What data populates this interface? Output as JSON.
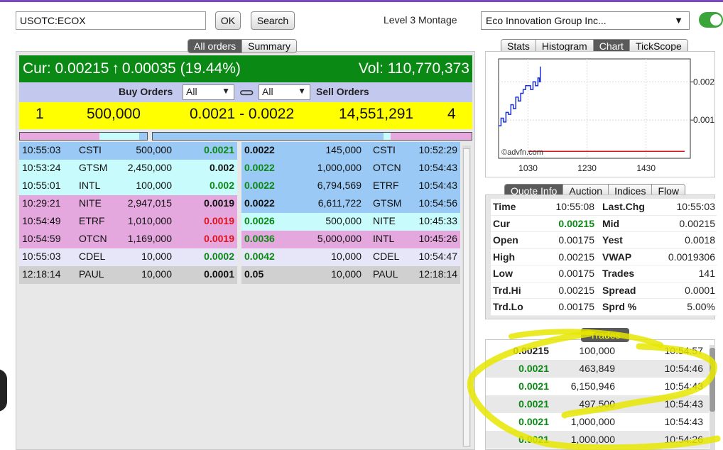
{
  "header": {
    "symbol_value": "USOTC:ECOX",
    "ok_label": "OK",
    "search_label": "Search",
    "montage_label": "Level 3 Montage",
    "company_selected": "Eco Innovation Group Inc...",
    "toggle_on": true
  },
  "left_tabs": [
    {
      "label": "All orders",
      "active": true
    },
    {
      "label": "Summary",
      "active": false
    }
  ],
  "current": {
    "cur_label": "Cur: 0.00215",
    "arrow": "↑",
    "change": "0.00035 (19.44%)",
    "vol": "Vol: 110,770,373"
  },
  "orders_head": {
    "buy_label": "Buy Orders",
    "buy_filter": "All",
    "sell_filter": "All",
    "sell_label": "Sell Orders",
    "link_icon": "link-icon"
  },
  "summary": {
    "buy_count": "1",
    "buy_size": "500,000",
    "spread": "0.0021 - 0.0022",
    "sell_size": "14,551,291",
    "sell_count": "4"
  },
  "buy_orders": [
    {
      "time": "10:55:03",
      "mm": "CSTI",
      "size": "500,000",
      "price": "0.0021",
      "style": "g",
      "bg": "#99c9f4"
    },
    {
      "time": "10:53:24",
      "mm": "GTSM",
      "size": "2,450,000",
      "price": "0.002",
      "style": "b",
      "bg": "#c8fcfc"
    },
    {
      "time": "10:55:01",
      "mm": "INTL",
      "size": "100,000",
      "price": "0.002",
      "style": "g",
      "bg": "#c8fcfc"
    },
    {
      "time": "10:29:21",
      "mm": "NITE",
      "size": "2,947,015",
      "price": "0.0019",
      "style": "b",
      "bg": "#e4a8de"
    },
    {
      "time": "10:54:49",
      "mm": "ETRF",
      "size": "1,010,000",
      "price": "0.0019",
      "style": "red",
      "bg": "#e4a8de"
    },
    {
      "time": "10:54:59",
      "mm": "OTCN",
      "size": "1,169,000",
      "price": "0.0019",
      "style": "red",
      "bg": "#e4a8de"
    },
    {
      "time": "10:55:03",
      "mm": "CDEL",
      "size": "10,000",
      "price": "0.0002",
      "style": "g",
      "bg": "#e6e6f8"
    },
    {
      "time": "12:18:14",
      "mm": "PAUL",
      "size": "10,000",
      "price": "0.0001",
      "style": "b",
      "bg": "#d0d0d0"
    }
  ],
  "sell_orders": [
    {
      "price": "0.0022",
      "style": "b",
      "size": "145,000",
      "mm": "CSTI",
      "time": "10:52:29",
      "bg": "#99c9f4"
    },
    {
      "price": "0.0022",
      "style": "g",
      "size": "1,000,000",
      "mm": "OTCN",
      "time": "10:54:43",
      "bg": "#99c9f4"
    },
    {
      "price": "0.0022",
      "style": "g",
      "size": "6,794,569",
      "mm": "ETRF",
      "time": "10:54:43",
      "bg": "#99c9f4"
    },
    {
      "price": "0.0022",
      "style": "b",
      "size": "6,611,722",
      "mm": "GTSM",
      "time": "10:54:56",
      "bg": "#99c9f4"
    },
    {
      "price": "0.0026",
      "style": "g",
      "size": "500,000",
      "mm": "NITE",
      "time": "10:45:33",
      "bg": "#c8fcfc"
    },
    {
      "price": "0.0036",
      "style": "g",
      "size": "5,000,000",
      "mm": "INTL",
      "time": "10:45:26",
      "bg": "#e4a8de"
    },
    {
      "price": "0.0042",
      "style": "g",
      "size": "10,000",
      "mm": "CDEL",
      "time": "10:54:47",
      "bg": "#e6e6f8"
    },
    {
      "price": "0.05",
      "style": "b",
      "size": "10,000",
      "mm": "PAUL",
      "time": "12:18:14",
      "bg": "#d0d0d0"
    }
  ],
  "chart_tabs": [
    {
      "label": "Stats",
      "active": false
    },
    {
      "label": "Histogram",
      "active": false
    },
    {
      "label": "Chart",
      "active": true
    },
    {
      "label": "TickScope",
      "active": false
    }
  ],
  "chart_data": {
    "type": "line",
    "x_ticks": [
      "1030",
      "1230",
      "1430"
    ],
    "y_ticks": [
      "0.002",
      "0.001"
    ],
    "watermark": "©advfn.com",
    "price_series": [
      {
        "t": "09:30",
        "v": 0.00085
      },
      {
        "t": "09:35",
        "v": 0.00105
      },
      {
        "t": "09:40",
        "v": 0.00095
      },
      {
        "t": "09:45",
        "v": 0.0012
      },
      {
        "t": "09:50",
        "v": 0.00115
      },
      {
        "t": "09:55",
        "v": 0.0014
      },
      {
        "t": "10:00",
        "v": 0.0013
      },
      {
        "t": "10:05",
        "v": 0.0016
      },
      {
        "t": "10:10",
        "v": 0.0015
      },
      {
        "t": "10:15",
        "v": 0.0017
      },
      {
        "t": "10:20",
        "v": 0.0018
      },
      {
        "t": "10:25",
        "v": 0.0019
      },
      {
        "t": "10:30",
        "v": 0.0019
      },
      {
        "t": "10:35",
        "v": 0.0018
      },
      {
        "t": "10:40",
        "v": 0.002
      },
      {
        "t": "10:45",
        "v": 0.0019
      },
      {
        "t": "10:50",
        "v": 0.0021
      },
      {
        "t": "10:53",
        "v": 0.002
      },
      {
        "t": "10:55",
        "v": 0.0024
      }
    ],
    "prev_close": 0.00018,
    "y_range": [
      0,
      0.0026
    ]
  },
  "quote_tabs": [
    {
      "label": "Quote Info",
      "active": true
    },
    {
      "label": "Auction",
      "active": false
    },
    {
      "label": "Indices",
      "active": false
    },
    {
      "label": "Flow",
      "active": false
    }
  ],
  "quote_info": [
    {
      "l1": "Time",
      "v1": "10:55:08",
      "v1_style": "",
      "l2": "Last.Chg",
      "v2": "10:55:03"
    },
    {
      "l1": "Cur",
      "v1": "0.00215",
      "v1_style": "g",
      "l2": "Mid",
      "v2": "0.00215"
    },
    {
      "l1": "Open",
      "v1": "0.00175",
      "v1_style": "",
      "l2": "Yest",
      "v2": "0.0018"
    },
    {
      "l1": "High",
      "v1": "0.00215",
      "v1_style": "",
      "l2": "VWAP",
      "v2": "0.0019306"
    },
    {
      "l1": "Low",
      "v1": "0.00175",
      "v1_style": "",
      "l2": "Trades",
      "v2": "141"
    },
    {
      "l1": "Trd.Hi",
      "v1": "0.00215",
      "v1_style": "",
      "l2": "Spread",
      "v2": "0.0001"
    },
    {
      "l1": "Trd.Lo",
      "v1": "0.00175",
      "v1_style": "",
      "l2": "Sprd %",
      "v2": "5.00%"
    }
  ],
  "trades_label": "Trades",
  "trades": [
    {
      "price": "0.00215",
      "style": "b",
      "size": "100,000",
      "time": "10:54:57",
      "bg": "#ffffff"
    },
    {
      "price": "0.0021",
      "style": "g",
      "size": "463,849",
      "time": "10:54:46",
      "bg": "#e8e8e8"
    },
    {
      "price": "0.0021",
      "style": "g",
      "size": "6,150,946",
      "time": "10:54:43",
      "bg": "#ffffff"
    },
    {
      "price": "0.0021",
      "style": "g",
      "size": "497,500",
      "time": "10:54:43",
      "bg": "#e8e8e8"
    },
    {
      "price": "0.0021",
      "style": "g",
      "size": "1,000,000",
      "time": "10:54:43",
      "bg": "#ffffff"
    },
    {
      "price": "0.0021",
      "style": "g",
      "size": "1,000,000",
      "time": "10:54:26",
      "bg": "#e8e8e8"
    }
  ]
}
